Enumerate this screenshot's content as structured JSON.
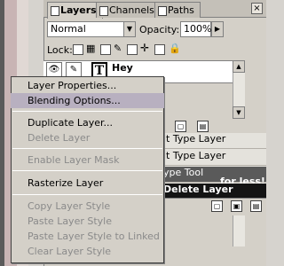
{
  "tabs": [
    {
      "label": "Layers",
      "active": true
    },
    {
      "label": "Channels",
      "active": false
    },
    {
      "label": "Paths",
      "active": false
    }
  ],
  "palette_close": "×",
  "blend_mode": {
    "value": "Normal"
  },
  "opacity": {
    "label": "Opacity:",
    "value": "100%"
  },
  "lock": {
    "label": "Lock:"
  },
  "layer": {
    "name": "Hey",
    "thumbnail": "T"
  },
  "background_rows": [
    {
      "text": "it Type Layer"
    },
    {
      "text": "it Type Layer"
    },
    {
      "text": "ype Tool"
    },
    {
      "text": "Delete Layer"
    }
  ],
  "less_text": "for less!",
  "context_menu": {
    "items": [
      {
        "label": "Layer Properties...",
        "enabled": true,
        "highlighted": false
      },
      {
        "label": "Blending Options...",
        "enabled": true,
        "highlighted": true
      },
      {
        "label": "Duplicate Layer...",
        "enabled": true,
        "highlighted": false
      },
      {
        "label": "Delete Layer",
        "enabled": false,
        "highlighted": false
      },
      {
        "label": "Enable Layer Mask",
        "enabled": false,
        "highlighted": false
      },
      {
        "label": "Rasterize Layer",
        "enabled": true,
        "highlighted": false
      },
      {
        "label": "Copy Layer Style",
        "enabled": false,
        "highlighted": false
      },
      {
        "label": "Paste Layer Style",
        "enabled": false,
        "highlighted": false
      },
      {
        "label": "Paste Layer Style to Linked",
        "enabled": false,
        "highlighted": false
      },
      {
        "label": "Clear Layer Style",
        "enabled": false,
        "highlighted": false
      }
    ]
  },
  "icons": [
    "eye-icon",
    "brush-icon",
    "lock-transparency-icon",
    "lock-paint-icon",
    "lock-move-icon",
    "lock-all-icon",
    "dropdown-arrow-icon",
    "scroll-up-icon",
    "scroll-down-icon"
  ],
  "colors": {
    "panel": "#d4d0c8",
    "menu_highlight": "#b8b0c0",
    "selected_row": "#141414"
  }
}
